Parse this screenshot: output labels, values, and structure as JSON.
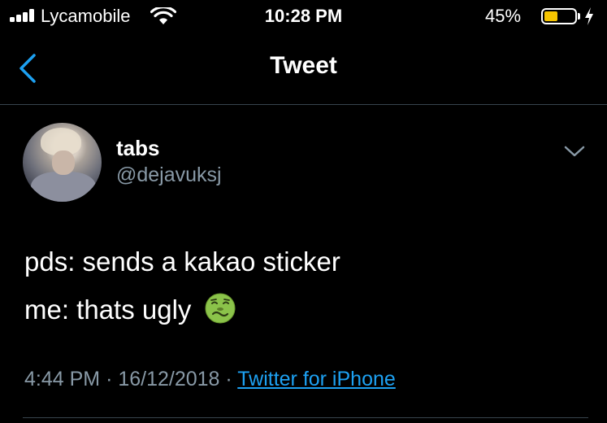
{
  "status_bar": {
    "carrier": "Lycamobile",
    "time": "10:28 PM",
    "battery_percent": "45%",
    "battery_level": 0.45,
    "icons": [
      "signal-icon",
      "wifi-icon",
      "battery-icon",
      "charging-bolt-icon"
    ],
    "battery_color": "#f5c400"
  },
  "nav": {
    "title": "Tweet",
    "back_icon": "chevron-left-icon",
    "accent": "#1da1f2"
  },
  "tweet": {
    "display_name": "tabs",
    "handle": "@dejavuksj",
    "text_line1": "pds: sends a kakao sticker",
    "text_line2": "me: thats ugly",
    "emoji": "nauseated-face-emoji",
    "time": "4:44 PM",
    "separator": "·",
    "date": "16/12/2018",
    "source": "Twitter for iPhone",
    "menu_icon": "chevron-down-icon"
  },
  "colors": {
    "background": "#000000",
    "secondary_text": "#8899a6",
    "divider": "#38444d"
  }
}
